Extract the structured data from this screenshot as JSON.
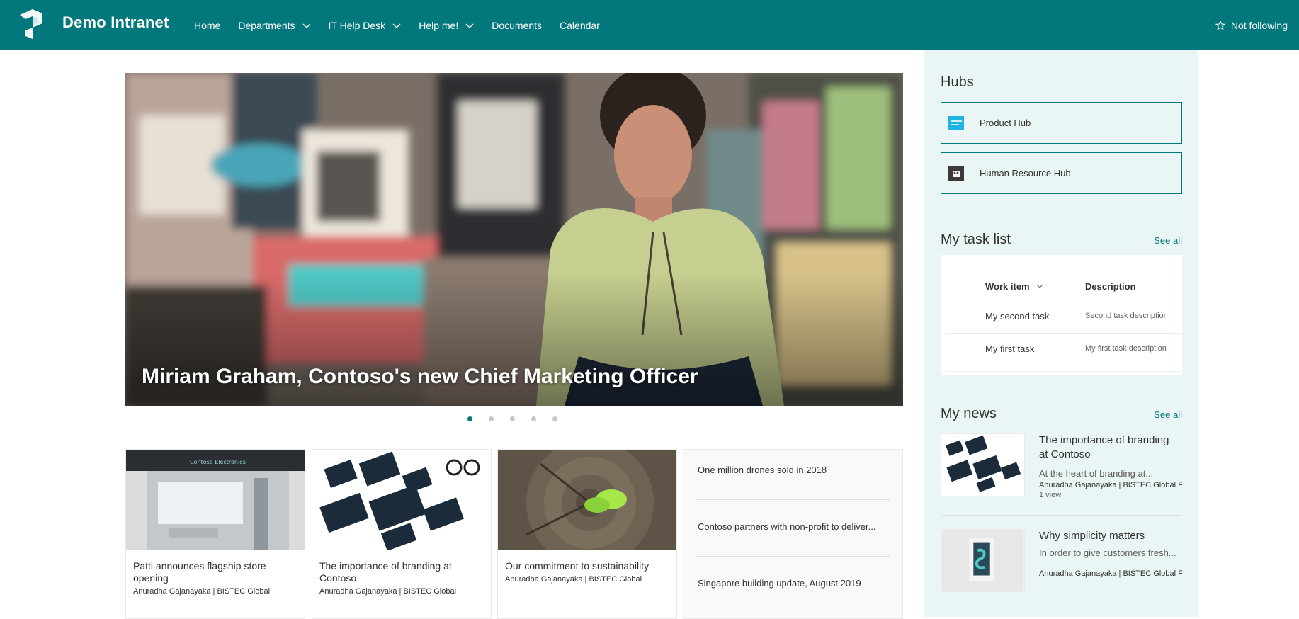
{
  "site": {
    "title": "Demo Intranet"
  },
  "nav": [
    {
      "label": "Home",
      "has_menu": false
    },
    {
      "label": "Departments",
      "has_menu": true
    },
    {
      "label": "IT Help Desk",
      "has_menu": true
    },
    {
      "label": "Help me!",
      "has_menu": true
    },
    {
      "label": "Documents",
      "has_menu": false
    },
    {
      "label": "Calendar",
      "has_menu": false
    }
  ],
  "follow": {
    "label": "Not following",
    "icon": "star-outline-icon"
  },
  "hero": {
    "title": "Miriam Graham, Contoso's new Chief Marketing Officer",
    "slide_count": 5,
    "active_slide": 1
  },
  "news_cards": [
    {
      "title": "Patti announces flagship store opening",
      "author": "Anuradha Gajanayaka | BISTEC Global"
    },
    {
      "title": "The importance of branding at Contoso",
      "author": "Anuradha Gajanayaka | BISTEC Global"
    },
    {
      "title": "Our commitment to sustainability",
      "author": "Anuradha Gajanayaka | BISTEC Global"
    }
  ],
  "news_links": [
    "One million drones sold in 2018",
    "Contoso partners with non-profit to deliver...",
    "Singapore building update, August 2019"
  ],
  "hubs": {
    "heading": "Hubs",
    "items": [
      {
        "label": "Product Hub",
        "icon": "product-hub-icon"
      },
      {
        "label": "Human Resource Hub",
        "icon": "hr-hub-icon"
      }
    ]
  },
  "tasks": {
    "heading": "My task list",
    "see_all": "See all",
    "columns": [
      "Work item",
      "Description"
    ],
    "rows": [
      {
        "item": "My second task",
        "description": "Second task description"
      },
      {
        "item": "My first task",
        "description": "My first task description"
      }
    ]
  },
  "my_news": {
    "heading": "My news",
    "see_all": "See all",
    "items": [
      {
        "title": "The importance of branding at Contoso",
        "desc": "At the heart of branding at...",
        "author": "Anuradha Gajanayaka | BISTEC Global F",
        "views": "1 view"
      },
      {
        "title": "Why simplicity matters",
        "desc": "In order to give customers fresh...",
        "author": "Anuradha Gajanayaka | BISTEC Global F",
        "views": ""
      }
    ]
  },
  "colors": {
    "brand": "#03787c",
    "panel": "#eaf5f5"
  }
}
